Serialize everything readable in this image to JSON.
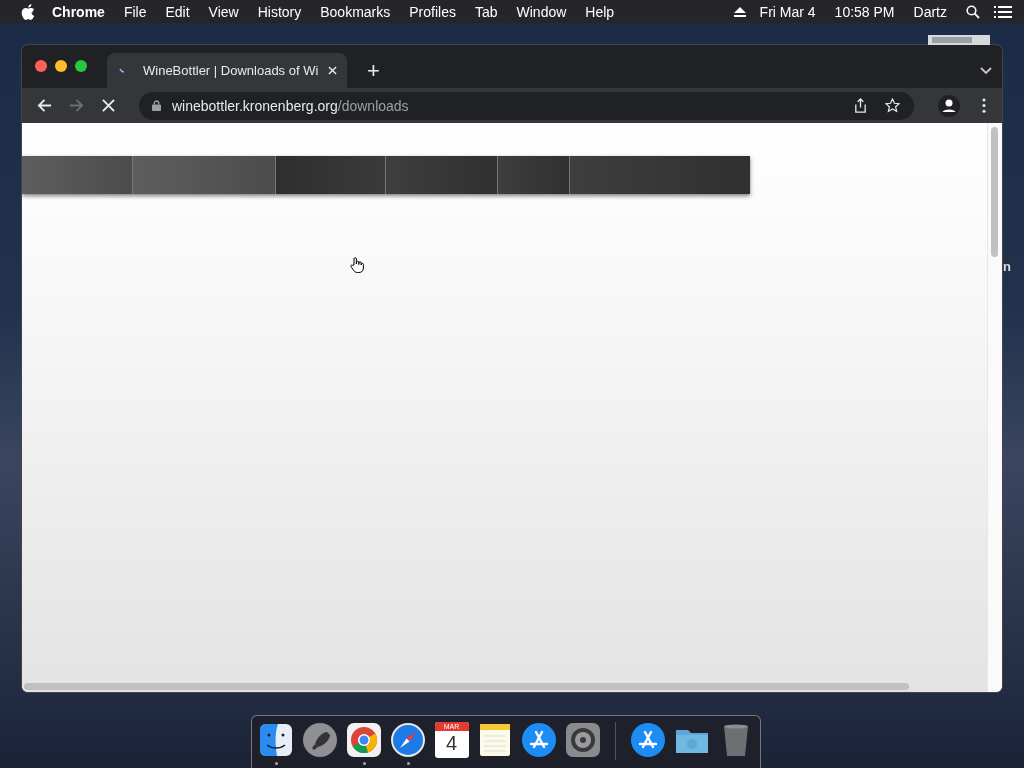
{
  "menu_bar": {
    "app": "Chrome",
    "menus": [
      "File",
      "Edit",
      "View",
      "History",
      "Bookmarks",
      "Profiles",
      "Tab",
      "Window",
      "Help"
    ],
    "date": "Fri Mar 4",
    "time": "10:58 PM",
    "user": "Dartz"
  },
  "browser": {
    "tabs": [
      {
        "title": "WineBottler | Downloads of Wi",
        "selected": true,
        "loading": true
      }
    ],
    "new_tab": "+",
    "address": {
      "domain": "winebottler.kronenberg.org",
      "path": "/downloads",
      "loading": true,
      "forward_disabled": true
    }
  },
  "page": {
    "nav_segments": [
      {
        "selected": false
      },
      {
        "selected": false
      },
      {
        "selected": true
      },
      {
        "selected": false
      },
      {
        "selected": false
      },
      {
        "selected": false
      }
    ]
  },
  "desktop_label": "n",
  "dock": {
    "items": [
      {
        "kind": "finder",
        "running": true
      },
      {
        "kind": "launchpad",
        "running": false
      },
      {
        "kind": "chrome",
        "running": true
      },
      {
        "kind": "safari",
        "running": true
      },
      {
        "kind": "calendar",
        "running": false,
        "month": "MAR",
        "day": "4"
      },
      {
        "kind": "notes",
        "running": false
      },
      {
        "kind": "appstore",
        "running": false
      },
      {
        "kind": "settings",
        "running": false
      },
      {
        "kind": "divider"
      },
      {
        "kind": "appstore",
        "running": false
      },
      {
        "kind": "folder",
        "running": false
      },
      {
        "kind": "trash",
        "running": false
      }
    ]
  }
}
